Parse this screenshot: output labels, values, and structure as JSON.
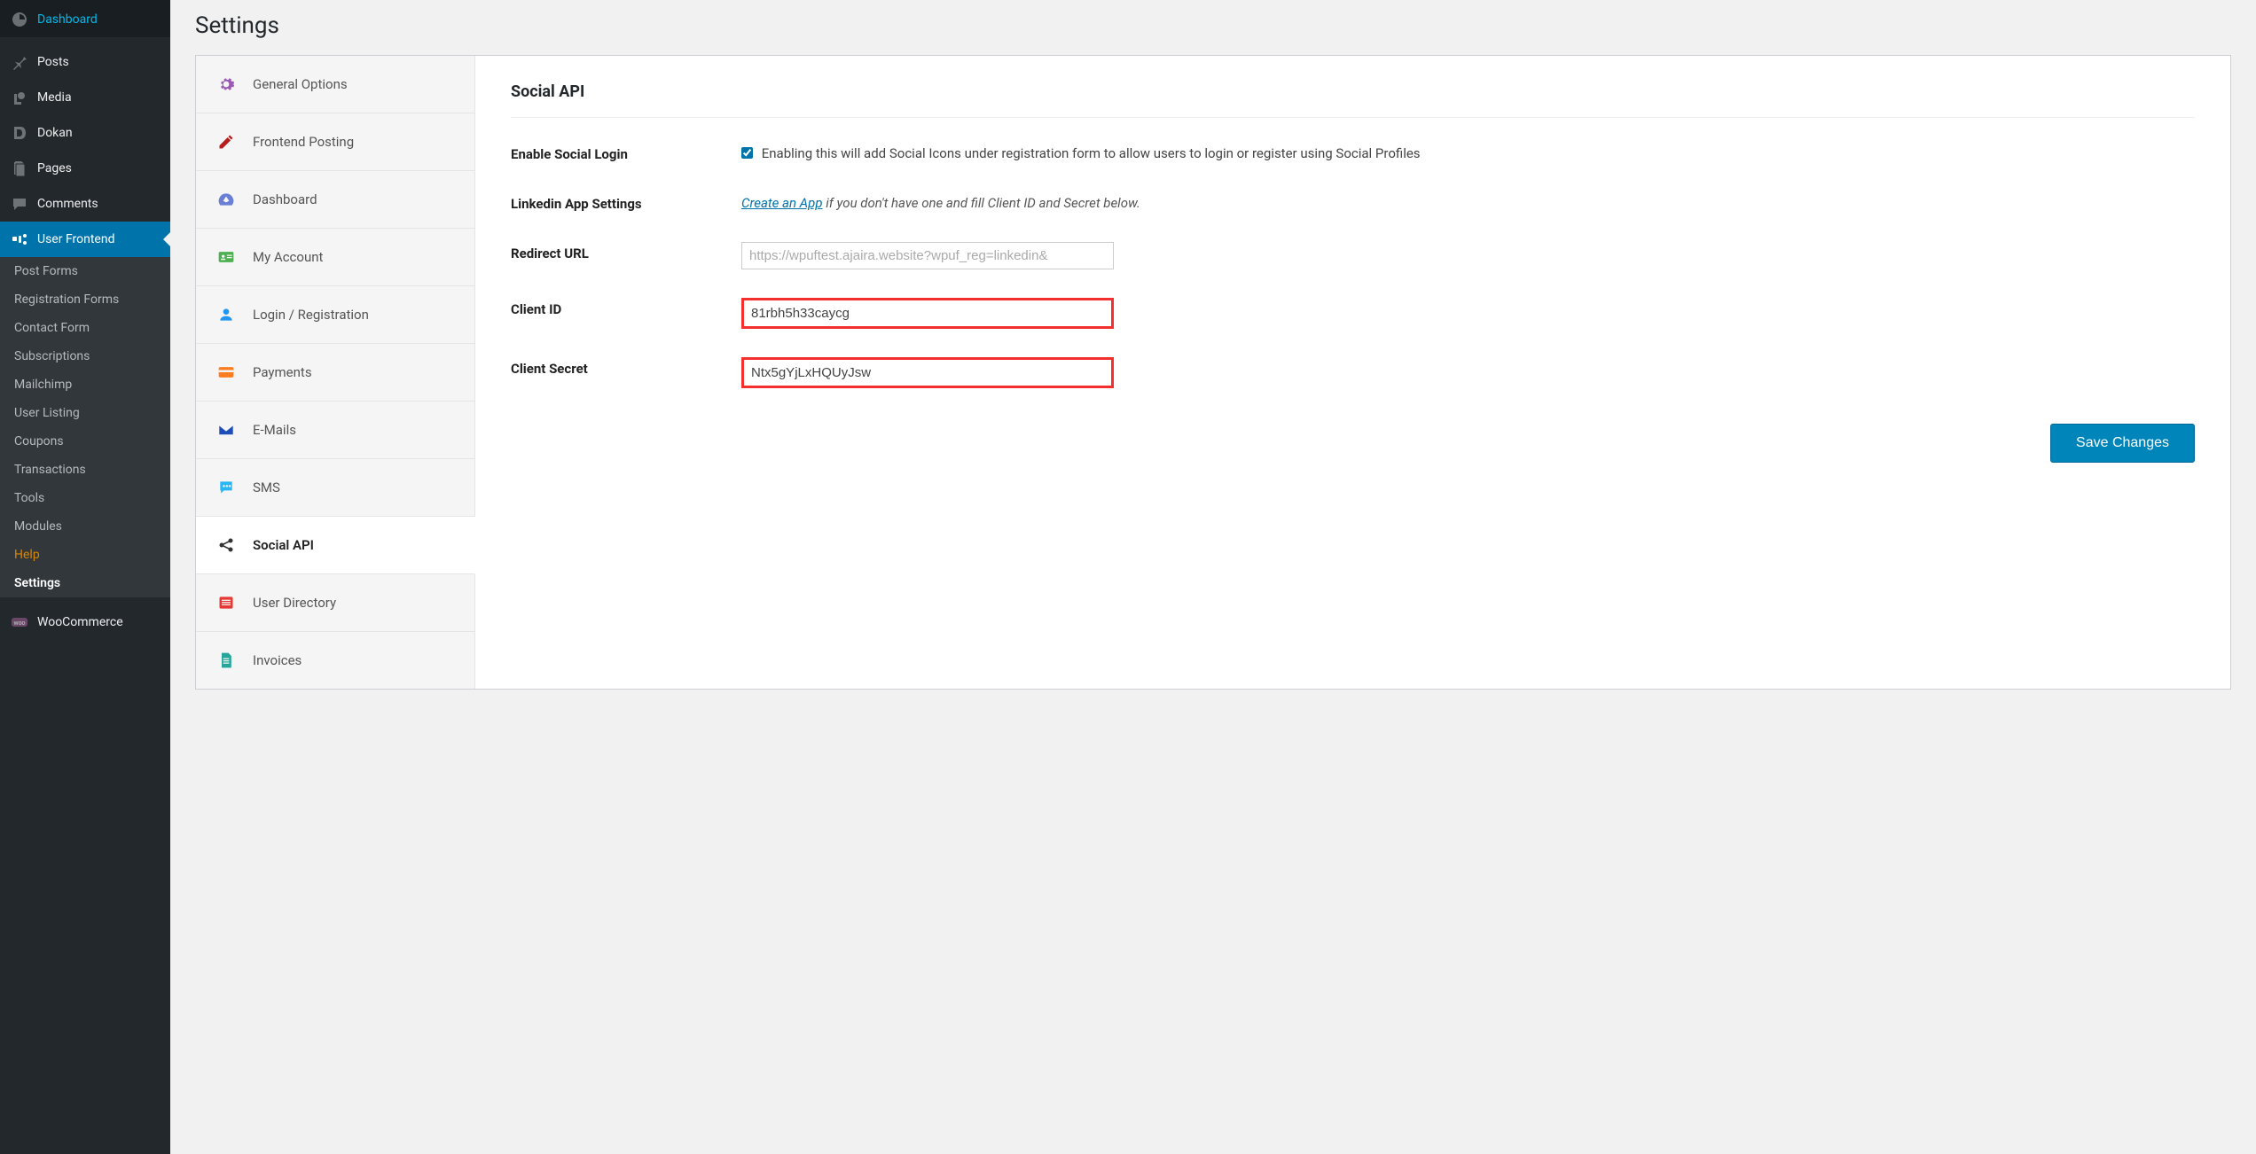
{
  "admin_menu": {
    "items": [
      {
        "name": "dashboard",
        "label": "Dashboard"
      },
      {
        "name": "posts",
        "label": "Posts"
      },
      {
        "name": "media",
        "label": "Media"
      },
      {
        "name": "dokan",
        "label": "Dokan"
      },
      {
        "name": "pages",
        "label": "Pages"
      },
      {
        "name": "comments",
        "label": "Comments"
      },
      {
        "name": "user-frontend",
        "label": "User Frontend"
      }
    ],
    "submenu": [
      {
        "name": "post-forms",
        "label": "Post Forms"
      },
      {
        "name": "registration-forms",
        "label": "Registration Forms"
      },
      {
        "name": "contact-form",
        "label": "Contact Form"
      },
      {
        "name": "subscriptions",
        "label": "Subscriptions"
      },
      {
        "name": "mailchimp",
        "label": "Mailchimp"
      },
      {
        "name": "user-listing",
        "label": "User Listing"
      },
      {
        "name": "coupons",
        "label": "Coupons"
      },
      {
        "name": "transactions",
        "label": "Transactions"
      },
      {
        "name": "tools",
        "label": "Tools"
      },
      {
        "name": "modules",
        "label": "Modules"
      },
      {
        "name": "help",
        "label": "Help"
      },
      {
        "name": "settings",
        "label": "Settings"
      }
    ],
    "woocommerce_label": "WooCommerce"
  },
  "page": {
    "title": "Settings"
  },
  "tabs": [
    {
      "name": "general-options",
      "label": "General Options"
    },
    {
      "name": "frontend-posting",
      "label": "Frontend Posting"
    },
    {
      "name": "dashboard",
      "label": "Dashboard"
    },
    {
      "name": "my-account",
      "label": "My Account"
    },
    {
      "name": "login-registration",
      "label": "Login / Registration"
    },
    {
      "name": "payments",
      "label": "Payments"
    },
    {
      "name": "emails",
      "label": "E-Mails"
    },
    {
      "name": "sms",
      "label": "SMS"
    },
    {
      "name": "social-api",
      "label": "Social API"
    },
    {
      "name": "user-directory",
      "label": "User Directory"
    },
    {
      "name": "invoices",
      "label": "Invoices"
    }
  ],
  "section": {
    "title": "Social API"
  },
  "form": {
    "enable_social_login": {
      "label": "Enable Social Login",
      "checked": true,
      "description": "Enabling this will add Social Icons under registration form to allow users to login or register using Social Profiles"
    },
    "linkedin_app": {
      "label": "Linkedin App Settings",
      "link_text": "Create an App",
      "suffix": " if you don't have one and fill Client ID and Secret below."
    },
    "redirect_url": {
      "label": "Redirect URL",
      "placeholder": "https://wpuftest.ajaira.website?wpuf_reg=linkedin&"
    },
    "client_id": {
      "label": "Client ID",
      "value": "81rbh5h33caycg"
    },
    "client_secret": {
      "label": "Client Secret",
      "value": "Ntx5gYjLxHQUyJsw"
    },
    "save_label": "Save Changes"
  }
}
